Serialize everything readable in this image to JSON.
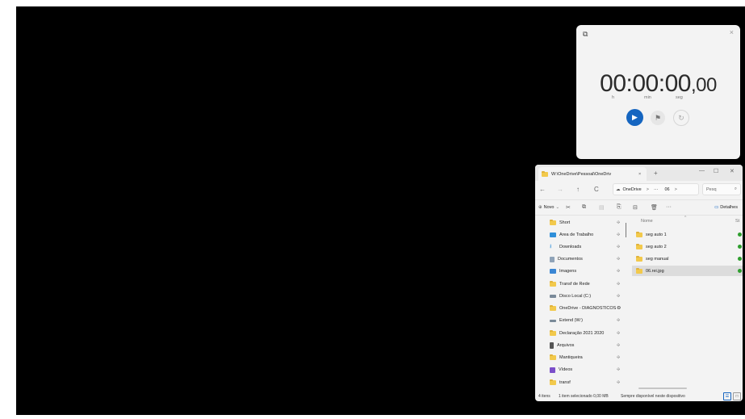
{
  "stopwatch": {
    "time_main": "00:00:00",
    "time_frac": ",00",
    "units": [
      "h",
      "min",
      "seg"
    ],
    "pip_icon": "picture-in-picture-icon",
    "close_icon": "close-icon",
    "accent": "#1565c0"
  },
  "explorer": {
    "tab_title": "W:\\OneDrive\\Pessoal\\OneDriv",
    "tab_close": "×",
    "tab_new": "+",
    "window_controls": [
      "—",
      "☐",
      "✕"
    ],
    "nav": {
      "back": "←",
      "forward": "→",
      "up": "↑",
      "refresh": "C"
    },
    "address": {
      "cloud_icon": "☁",
      "root": "OneDrive",
      "sep1": ">",
      "ellipsis": "···",
      "folder": "06",
      "sep2": ">"
    },
    "search": {
      "placeholder": "Pesq",
      "icon": "⌕"
    },
    "toolbar": {
      "new_label": "Novo",
      "details_label": "Detalhes",
      "more": "···"
    },
    "sidebar_items": [
      {
        "label": "Short",
        "icon": "folder-icon",
        "pin": "✣"
      },
      {
        "label": "Área de Trabalho",
        "icon": "desktop-icon",
        "pin": "✣"
      },
      {
        "label": "Downloads",
        "icon": "download-icon",
        "pin": "✣"
      },
      {
        "label": "Documentos",
        "icon": "document-icon",
        "pin": "✣"
      },
      {
        "label": "Imagens",
        "icon": "image-icon",
        "pin": "✣"
      },
      {
        "label": "Transf de Rede",
        "icon": "folder-icon",
        "pin": "✣"
      },
      {
        "label": "Disco Local (C:)",
        "icon": "drive-icon",
        "pin": "✣"
      },
      {
        "label": "OneDrive - DIAGNOSTICOS D...",
        "icon": "folder-icon",
        "pin": "✣"
      },
      {
        "label": "Extend (W:)",
        "icon": "drive-icon",
        "pin": "✣"
      },
      {
        "label": "Declaração 2021 2020",
        "icon": "folder-icon",
        "pin": "✣"
      },
      {
        "label": "Arquivos",
        "icon": "archive-icon",
        "pin": "✣"
      },
      {
        "label": "Mantiqueira",
        "icon": "folder-icon",
        "pin": "✣"
      },
      {
        "label": "Vídeos",
        "icon": "video-icon",
        "pin": "✣"
      },
      {
        "label": "transf",
        "icon": "folder-icon",
        "pin": "✣"
      }
    ],
    "list_header": {
      "name": "Nome",
      "status": "St"
    },
    "files": [
      {
        "name": "seg auto 1",
        "selected": false
      },
      {
        "name": "seg auto 2",
        "selected": false
      },
      {
        "name": "seg manual",
        "selected": false
      },
      {
        "name": "06.rei.jpg",
        "selected": true
      }
    ],
    "status_bar": {
      "count": "4 itens",
      "selection": "1 item selecionado 0,00 MB",
      "availability": "Sempre disponível neste dispositivo"
    }
  }
}
